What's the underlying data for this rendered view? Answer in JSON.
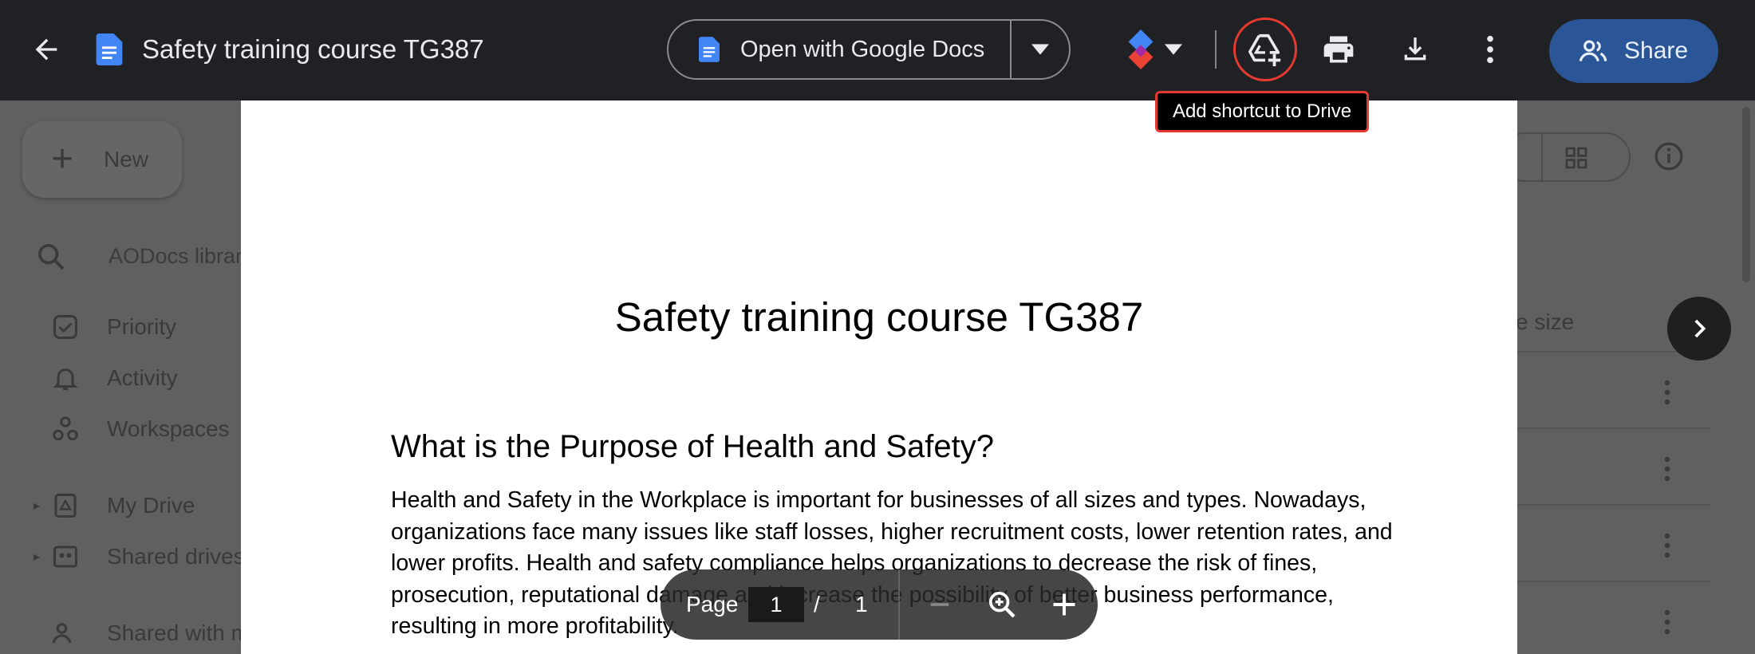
{
  "header": {
    "title": "Safety training course TG387",
    "open_with_label": "Open with Google Docs",
    "share_label": "Share"
  },
  "tooltip": {
    "text": "Add shortcut to Drive"
  },
  "icons": {
    "back": "arrow-left-icon",
    "doc": "google-docs-icon",
    "workflow": "workflow-icon",
    "shortcut": "add-to-drive-icon",
    "print": "printer-icon",
    "download": "download-icon",
    "more": "more-vert-icon",
    "share": "people-icon",
    "next": "chevron-right-icon"
  },
  "colors": {
    "topbar": "#202124",
    "share_button": "#2a5597",
    "highlight": "#e53a2f",
    "doc_icon": "#4285f4"
  },
  "document": {
    "title": "Safety training course TG387",
    "heading": "What is the Purpose of Health and Safety?",
    "paragraph": "Health and Safety in the Workplace is important for businesses of all sizes and types. Nowadays, organizations face many issues like staff losses, higher recruitment costs, lower retention rates, and lower profits. Health and safety compliance helps organizations to decrease the risk of fines, prosecution, reputational damage and increase the possibility of better business performance, resulting in more profitability."
  },
  "page_toolbar": {
    "page_label": "Page",
    "current_page": "1",
    "separator": "/",
    "total_pages": "1"
  },
  "background": {
    "new_label": "New",
    "search_placeholder": "AODocs librar",
    "nav": {
      "priority": "Priority",
      "activity": "Activity",
      "workspaces": "Workspaces",
      "my_drive": "My Drive",
      "shared_drives": "Shared drives",
      "shared_with_me": "Shared with m"
    },
    "file_size_header": "e size"
  }
}
